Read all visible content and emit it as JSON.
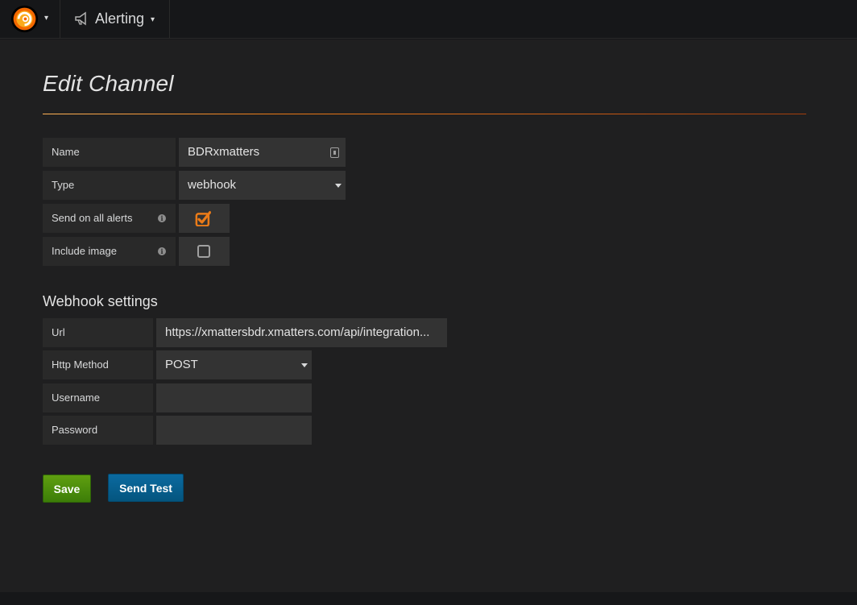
{
  "topbar": {
    "section_title": "Alerting"
  },
  "page": {
    "title": "Edit Channel"
  },
  "channel": {
    "name_label": "Name",
    "name_value": "BDRxmatters",
    "type_label": "Type",
    "type_value": "webhook",
    "send_all_label": "Send on all alerts",
    "send_all_checked": true,
    "include_image_label": "Include image",
    "include_image_checked": false
  },
  "webhook": {
    "heading": "Webhook settings",
    "url_label": "Url",
    "url_value": "https://xmattersbdr.xmatters.com/api/integration...",
    "method_label": "Http Method",
    "method_value": "POST",
    "username_label": "Username",
    "username_value": "",
    "password_label": "Password",
    "password_value": ""
  },
  "actions": {
    "save_label": "Save",
    "test_label": "Send Test"
  },
  "colors": {
    "accent": "#eb7b18",
    "save": "#4a8f0c",
    "test": "#0a5f8f",
    "panel": "#1f1f20",
    "navbar": "#161719"
  },
  "icons": [
    "grafana-logo-icon",
    "megaphone-icon",
    "contact-card-icon",
    "info-icon",
    "caret-down-icon",
    "checkbox-checked-icon",
    "checkbox-empty-icon"
  ]
}
